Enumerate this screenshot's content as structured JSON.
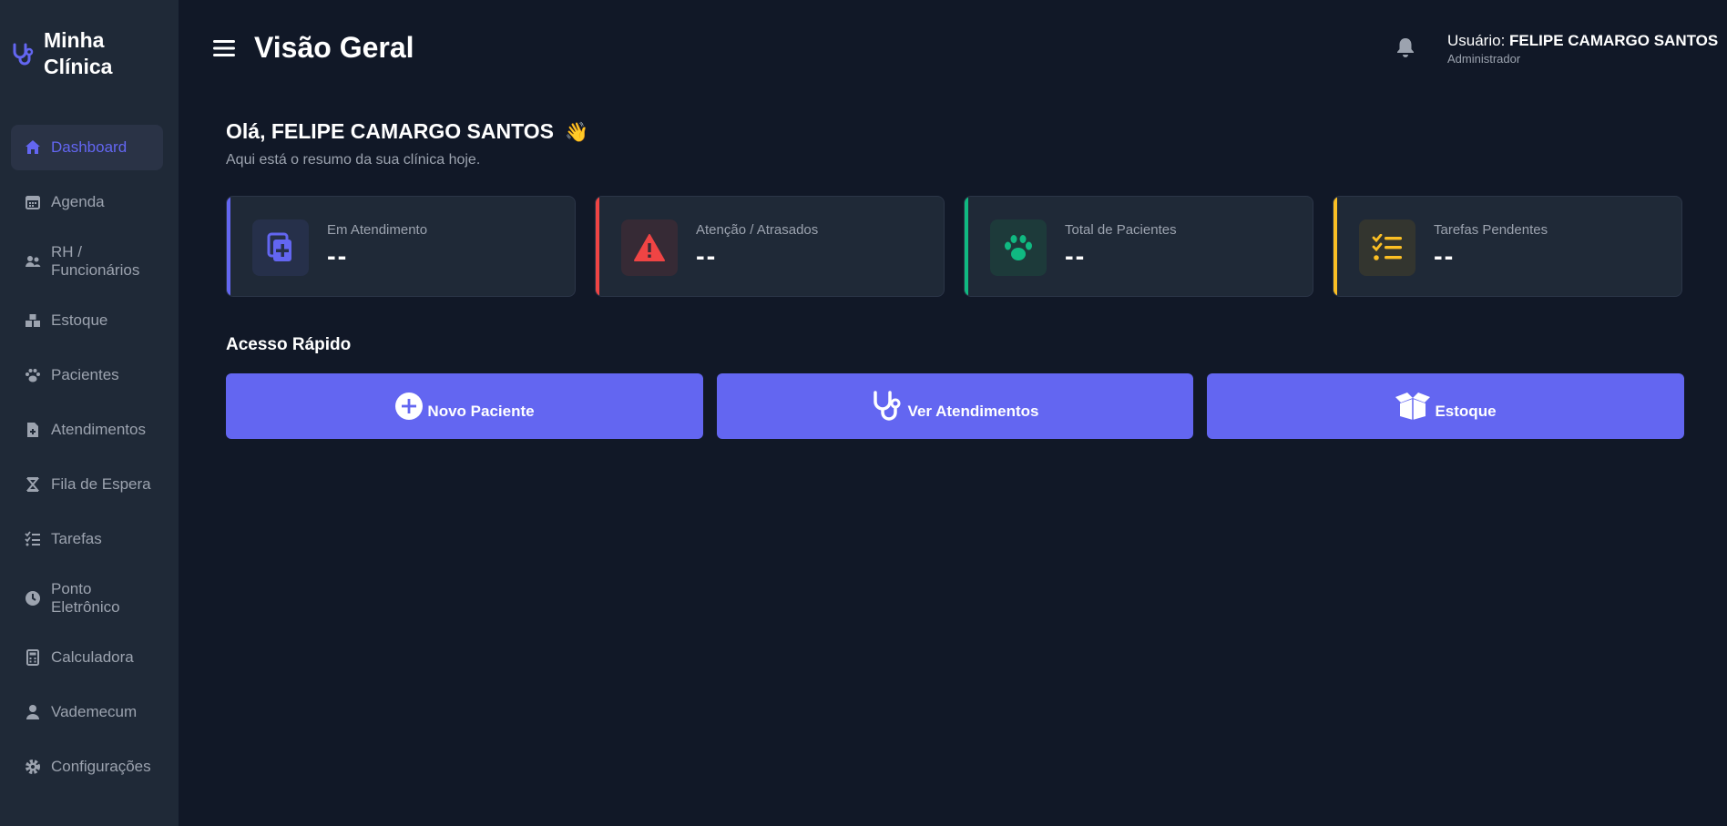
{
  "brand": {
    "title": "Minha Clínica",
    "icon": "stethoscope-icon"
  },
  "sidebar": {
    "items": [
      {
        "label": "Dashboard",
        "icon": "home-icon",
        "active": true
      },
      {
        "label": "Agenda",
        "icon": "calendar-icon"
      },
      {
        "label": "RH / Funcionários",
        "icon": "users-icon"
      },
      {
        "label": "Estoque",
        "icon": "boxes-icon"
      },
      {
        "label": "Pacientes",
        "icon": "paw-icon"
      },
      {
        "label": "Atendimentos",
        "icon": "file-medical-icon"
      },
      {
        "label": "Fila de Espera",
        "icon": "hourglass-icon"
      },
      {
        "label": "Tarefas",
        "icon": "list-check-icon"
      },
      {
        "label": "Ponto Eletrônico",
        "icon": "clock-icon"
      },
      {
        "label": "Calculadora",
        "icon": "calculator-icon"
      },
      {
        "label": "Vademecum",
        "icon": "user-doctor-icon"
      },
      {
        "label": "Configurações",
        "icon": "gear-icon"
      }
    ]
  },
  "header": {
    "title": "Visão Geral",
    "user_prefix": "Usuário:",
    "user_name": "FELIPE CAMARGO SANTOS",
    "user_role": "Administrador"
  },
  "greeting": {
    "title": "Olá, FELIPE CAMARGO SANTOS",
    "emoji": "👋",
    "subtitle": "Aqui está o resumo da sua clínica hoje."
  },
  "stats": [
    {
      "label": "Em Atendimento",
      "value": "--",
      "color": "#6366f1",
      "icon": "notes-medical-icon"
    },
    {
      "label": "Atenção / Atrasados",
      "value": "--",
      "color": "#ef4444",
      "icon": "warning-icon"
    },
    {
      "label": "Total de Pacientes",
      "value": "--",
      "color": "#10b981",
      "icon": "paw-icon"
    },
    {
      "label": "Tarefas Pendentes",
      "value": "--",
      "color": "#fbbf24",
      "icon": "list-check-icon"
    }
  ],
  "quick_access": {
    "title": "Acesso Rápido",
    "buttons": [
      {
        "label": "Novo Paciente",
        "icon": "plus-circle-icon"
      },
      {
        "label": "Ver Atendimentos",
        "icon": "stethoscope-icon"
      },
      {
        "label": "Estoque",
        "icon": "box-open-icon"
      }
    ]
  },
  "colors": {
    "accent": "#6366f1",
    "background": "#111827",
    "sidebar": "#1f2937"
  }
}
